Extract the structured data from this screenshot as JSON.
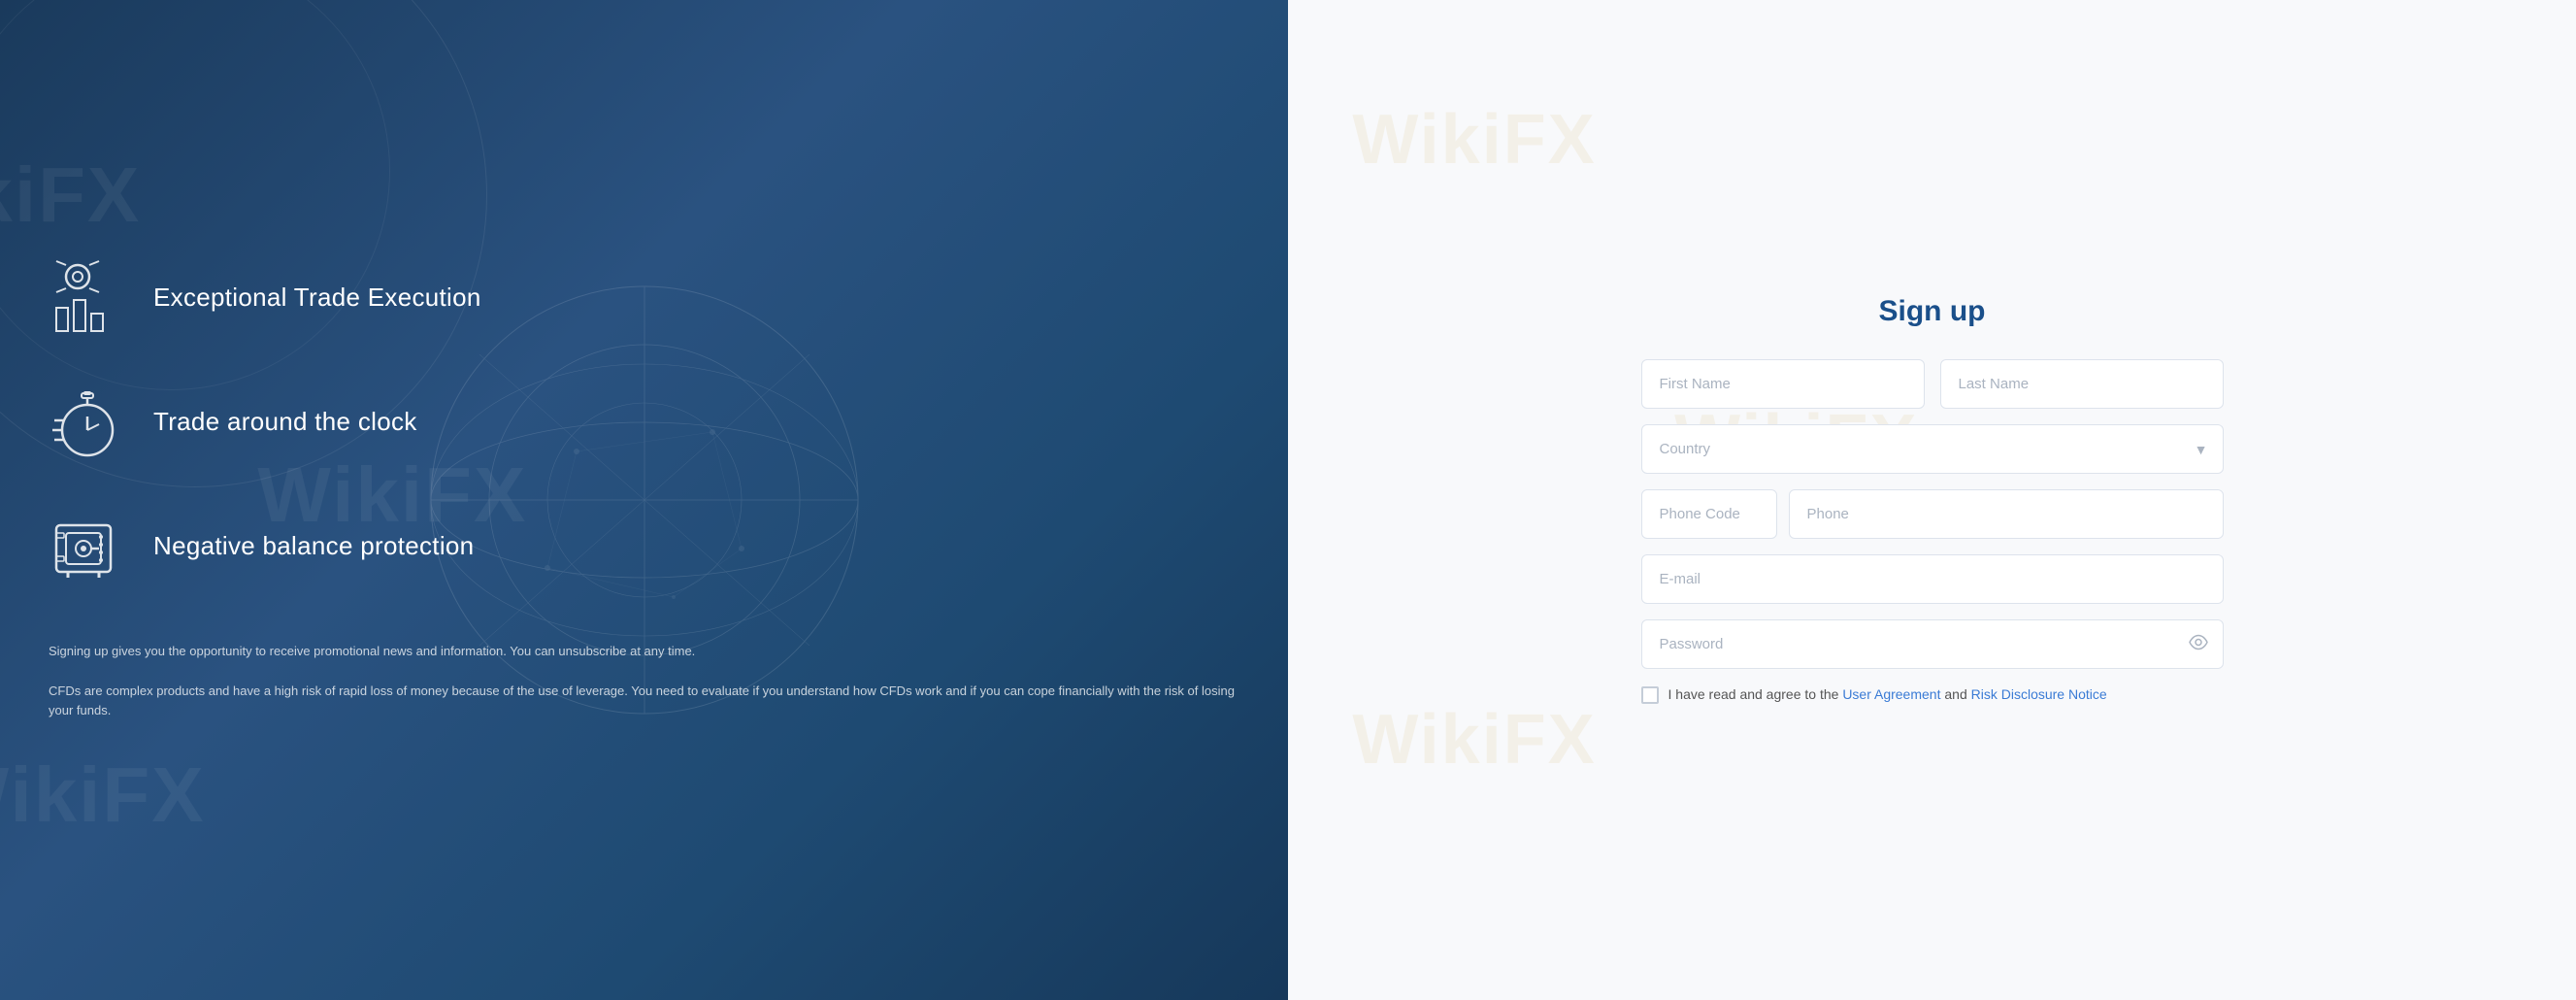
{
  "left": {
    "features": [
      {
        "id": "trade-execution",
        "title": "Exceptional Trade Execution",
        "icon": "trade-execution-icon"
      },
      {
        "id": "trade-clock",
        "title": "Trade around the clock",
        "icon": "clock-icon"
      },
      {
        "id": "balance-protection",
        "title": "Negative balance protection",
        "icon": "safe-icon"
      }
    ],
    "disclaimer1": "Signing up gives you the opportunity to receive promotional news and information. You can unsubscribe at any time.",
    "disclaimer2": "CFDs are complex products and have a high risk of rapid loss of money because of the use of leverage. You need to evaluate if you understand how CFDs work and if you can cope financially with the risk of losing your funds."
  },
  "right": {
    "title": "Sign up",
    "form": {
      "first_name_placeholder": "First Name",
      "last_name_placeholder": "Last Name",
      "country_placeholder": "Country",
      "phone_code_placeholder": "Phone Code",
      "phone_placeholder": "Phone",
      "email_placeholder": "E-mail",
      "password_placeholder": "Password",
      "agreement_text": "I have read and agree to the",
      "agreement_link1": "User Agreement",
      "agreement_and": "and",
      "agreement_link2": "Risk Disclosure Notice"
    }
  }
}
